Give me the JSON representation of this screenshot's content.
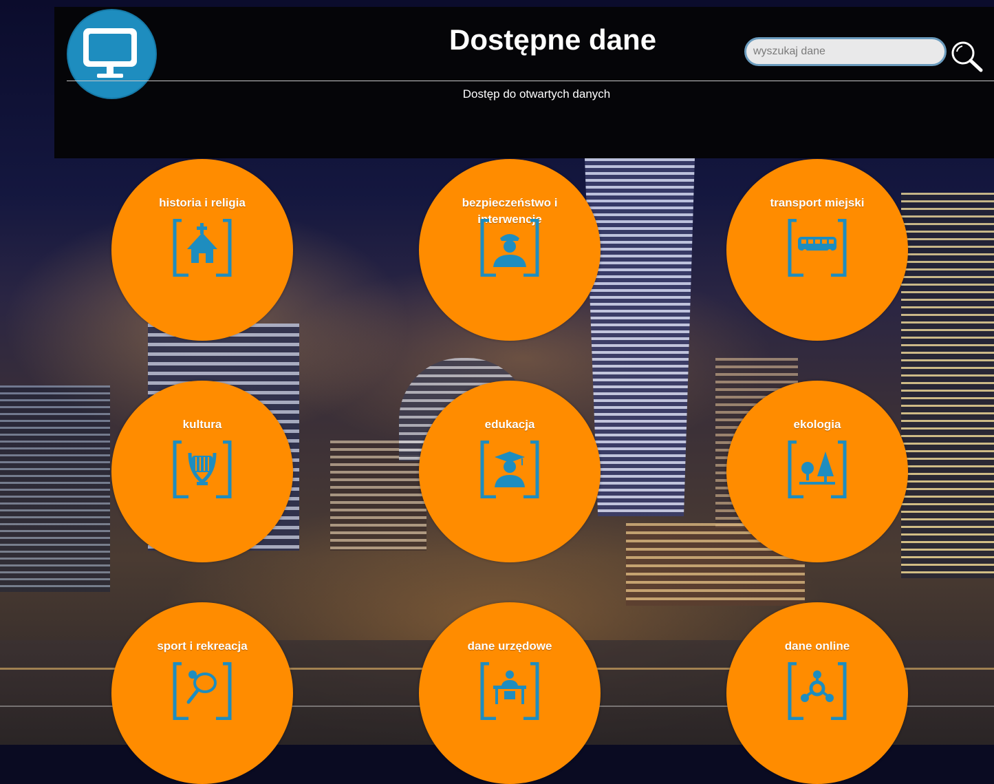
{
  "header": {
    "title": "Dostępne dane",
    "subtitle": "Dostęp do otwartych danych",
    "logo_icon": "monitor-icon",
    "search": {
      "placeholder": "wyszukaj dane",
      "value": "",
      "button_icon": "search-icon"
    }
  },
  "categories": [
    {
      "label": "historia i religia",
      "icon": "church-icon"
    },
    {
      "label": "bezpieczeństwo i interwencje",
      "icon": "police-officer-icon"
    },
    {
      "label": "transport miejski",
      "icon": "bus-icon"
    },
    {
      "label": "kultura",
      "icon": "lyre-icon"
    },
    {
      "label": "edukacja",
      "icon": "graduate-icon"
    },
    {
      "label": "ekologia",
      "icon": "trees-icon"
    },
    {
      "label": "sport i rekreacja",
      "icon": "racket-ball-icon"
    },
    {
      "label": "dane urzędowe",
      "icon": "office-clerk-icon"
    },
    {
      "label": "dane online",
      "icon": "network-nodes-icon"
    }
  ],
  "colors": {
    "circle": "#ff8c00",
    "icon": "#1e8dbf",
    "header_bg": "#050508",
    "logo_bg": "#1e8dbf"
  }
}
